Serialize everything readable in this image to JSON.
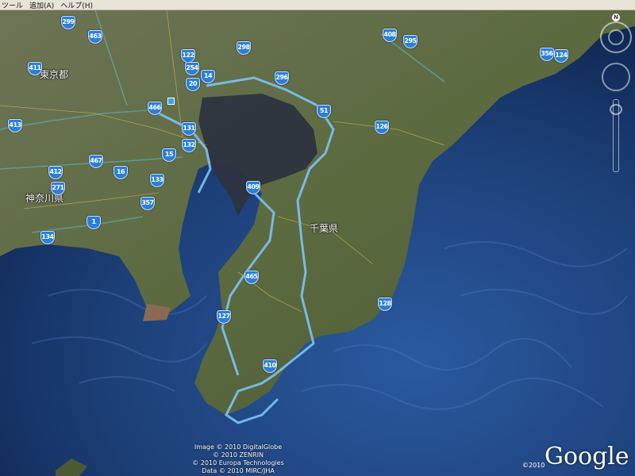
{
  "menu": {
    "tools": "ツール",
    "add": "追加(A)",
    "help": "ヘルプ(H)"
  },
  "places": {
    "tokyo": "東京都",
    "kanagawa": "神奈川県",
    "chiba": "千葉県"
  },
  "routes": [
    "299",
    "463",
    "411",
    "122",
    "298",
    "408",
    "295",
    "356",
    "124",
    "254",
    "14",
    "296",
    "20",
    "466",
    "51",
    "413",
    "131",
    "126",
    "132",
    "15",
    "467",
    "16",
    "412",
    "133",
    "409",
    "271",
    "357",
    "1",
    "134",
    "465",
    "128",
    "127",
    "410"
  ],
  "controls": {
    "north": "N"
  },
  "credits": [
    "Image © 2010 DigitalGlobe",
    "© 2010 ZENRIN",
    "© 2010 Europa Technologies",
    "Data © 2010 MIRC/JHA"
  ],
  "brand": {
    "year": "©2010",
    "logo": "Google"
  },
  "colors": {
    "sea": "#1d3f78",
    "land": "#5f6b43",
    "route": "#7cc3f4",
    "shield": "#2b7fd8"
  }
}
